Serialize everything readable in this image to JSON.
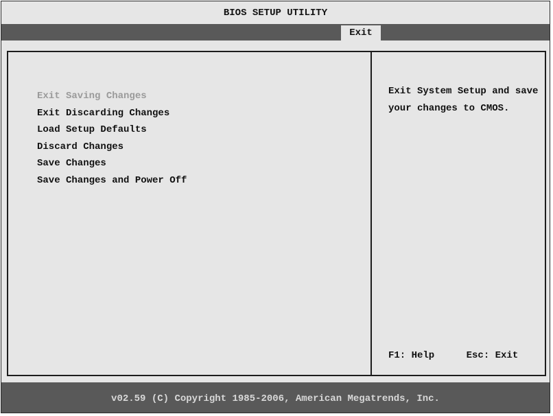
{
  "app": {
    "title": "BIOS SETUP UTILITY"
  },
  "menu": {
    "tabs": [
      {
        "label": "Exit",
        "active": true
      }
    ]
  },
  "options": [
    {
      "label": "Exit Saving Changes",
      "selected": true
    },
    {
      "label": "Exit Discarding Changes",
      "selected": false
    },
    {
      "label": "Load Setup Defaults",
      "selected": false
    },
    {
      "label": "Discard Changes",
      "selected": false
    },
    {
      "label": "Save Changes",
      "selected": false
    },
    {
      "label": "Save Changes and Power Off",
      "selected": false
    }
  ],
  "help": {
    "text": "Exit System Setup and save your changes to CMOS."
  },
  "keys": {
    "help": "F1: Help",
    "exit": "Esc: Exit"
  },
  "footer": {
    "copyright": "v02.59 (C) Copyright 1985-2006, American Megatrends, Inc."
  },
  "colors": {
    "background": "#e6e6e6",
    "bar": "#595959",
    "selected_text": "#9a9a9a",
    "text": "#111111"
  }
}
